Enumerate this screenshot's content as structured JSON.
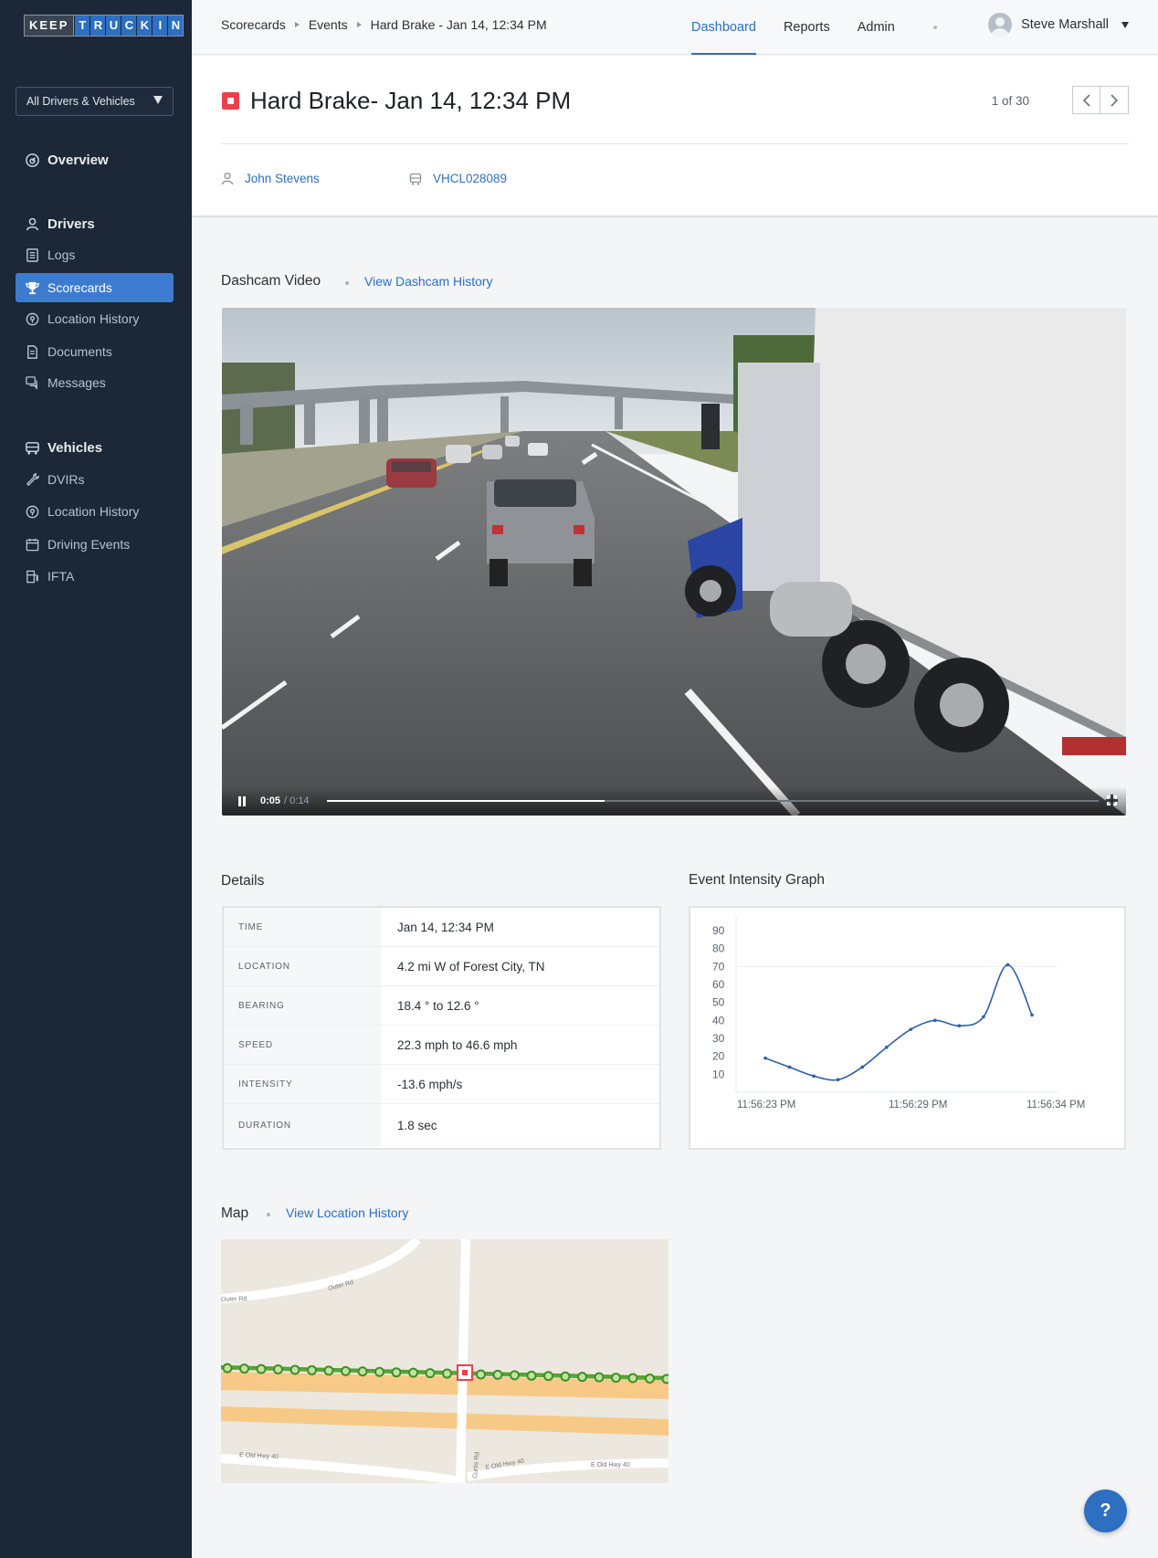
{
  "app": {
    "logo_left": "KEEP",
    "logo_right": [
      "T",
      "R",
      "U",
      "C",
      "K",
      "I",
      "N"
    ]
  },
  "sidebar": {
    "filter_label": "All Drivers & Vehicles",
    "overview": "Overview",
    "drivers_header": "Drivers",
    "driver_items": [
      "Logs",
      "Scorecards",
      "Location History",
      "Documents",
      "Messages"
    ],
    "vehicles_header": "Vehicles",
    "vehicle_items": [
      "DVIRs",
      "Location History",
      "Driving Events",
      "IFTA"
    ],
    "active_item": "Scorecards"
  },
  "topbar": {
    "breadcrumbs": [
      "Scorecards",
      "Events",
      "Hard Brake - Jan 14, 12:34 PM"
    ],
    "nav": [
      "Dashboard",
      "Reports",
      "Admin"
    ],
    "active_nav": "Dashboard",
    "user_name": "Steve Marshall"
  },
  "event": {
    "title": "Hard Brake- Jan 14, 12:34 PM",
    "pager": "1 of 30",
    "driver": "John Stevens",
    "vehicle": "VHCL028089"
  },
  "dashcam": {
    "title": "Dashcam Video",
    "link": "View Dashcam History",
    "current_time": "0:05",
    "total_time": "/ 0:14",
    "progress": 0.36
  },
  "details": {
    "title": "Details",
    "rows": [
      {
        "label": "Time",
        "value": "Jan 14, 12:34 PM"
      },
      {
        "label": "Location",
        "value": "4.2 mi W of Forest City, TN"
      },
      {
        "label": "Bearing",
        "value": "18.4 ° to 12.6 °"
      },
      {
        "label": "Speed",
        "value": "22.3 mph to 46.6 mph"
      },
      {
        "label": "Intensity",
        "value": "-13.6 mph/s"
      },
      {
        "label": "Duration",
        "value": "1.8 sec"
      }
    ]
  },
  "graph": {
    "title": "Event Intensity Graph"
  },
  "chart_data": {
    "type": "line",
    "title": "Event Intensity Graph",
    "y_ticks": [
      10,
      20,
      30,
      40,
      50,
      60,
      70,
      80,
      90
    ],
    "x_ticks": [
      "11:56:23 PM",
      "11:56:29 PM",
      "11:56:34 PM"
    ],
    "ylim": [
      0,
      90
    ],
    "x": [
      0,
      1,
      2,
      3,
      4,
      5,
      6,
      7,
      8,
      9,
      10,
      11
    ],
    "values": [
      19,
      14,
      9,
      7,
      14,
      25,
      35,
      40,
      37,
      42,
      71,
      43
    ],
    "series_color": "#2d5fa8",
    "grid": true
  },
  "map": {
    "title": "Map",
    "link": "View Location History",
    "roads": [
      "Outer Rd",
      "Outer Rd",
      "E Old Hwy 40",
      "E Old Hwy 40",
      "E Old Hwy 40",
      "Curtis Rd"
    ]
  },
  "help_label": "?"
}
